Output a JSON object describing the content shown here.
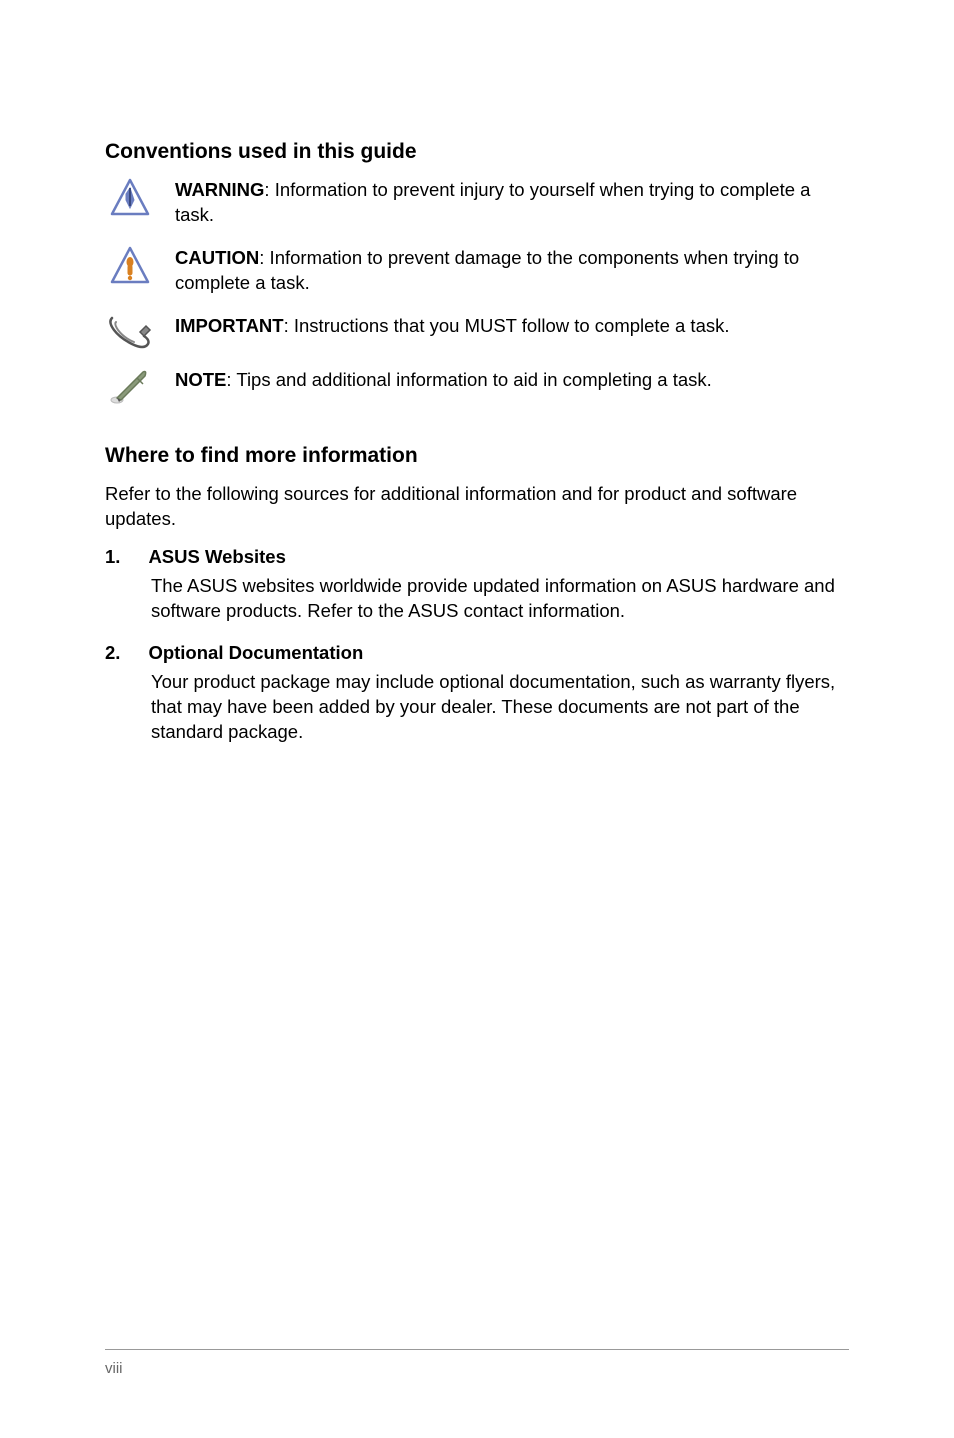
{
  "headings": {
    "conventions": "Conventions used in this guide",
    "where": "Where to find more information"
  },
  "conventions": {
    "warning": {
      "label": "WARNING",
      "text": ": Information to prevent injury to yourself when trying to complete a task."
    },
    "caution": {
      "label": "CAUTION",
      "text": ": Information to prevent damage to the components when trying to complete a task."
    },
    "important": {
      "label": "IMPORTANT",
      "text": ": Instructions that you MUST follow to complete a task."
    },
    "note": {
      "label": "NOTE",
      "text": ": Tips and additional information to aid in completing a task."
    }
  },
  "where_intro": "Refer to the following sources for additional information and for product and software updates.",
  "items": {
    "one": {
      "num": "1.",
      "heading": "ASUS Websites",
      "body": "The ASUS websites worldwide provide updated information on ASUS hardware and software products. Refer to the ASUS contact information."
    },
    "two": {
      "num": "2.",
      "heading": "Optional Documentation",
      "body": "Your product package may include optional documentation, such as warranty flyers, that may have been added by your dealer. These documents are not part of the standard package."
    }
  },
  "footer": {
    "page": "viii"
  }
}
